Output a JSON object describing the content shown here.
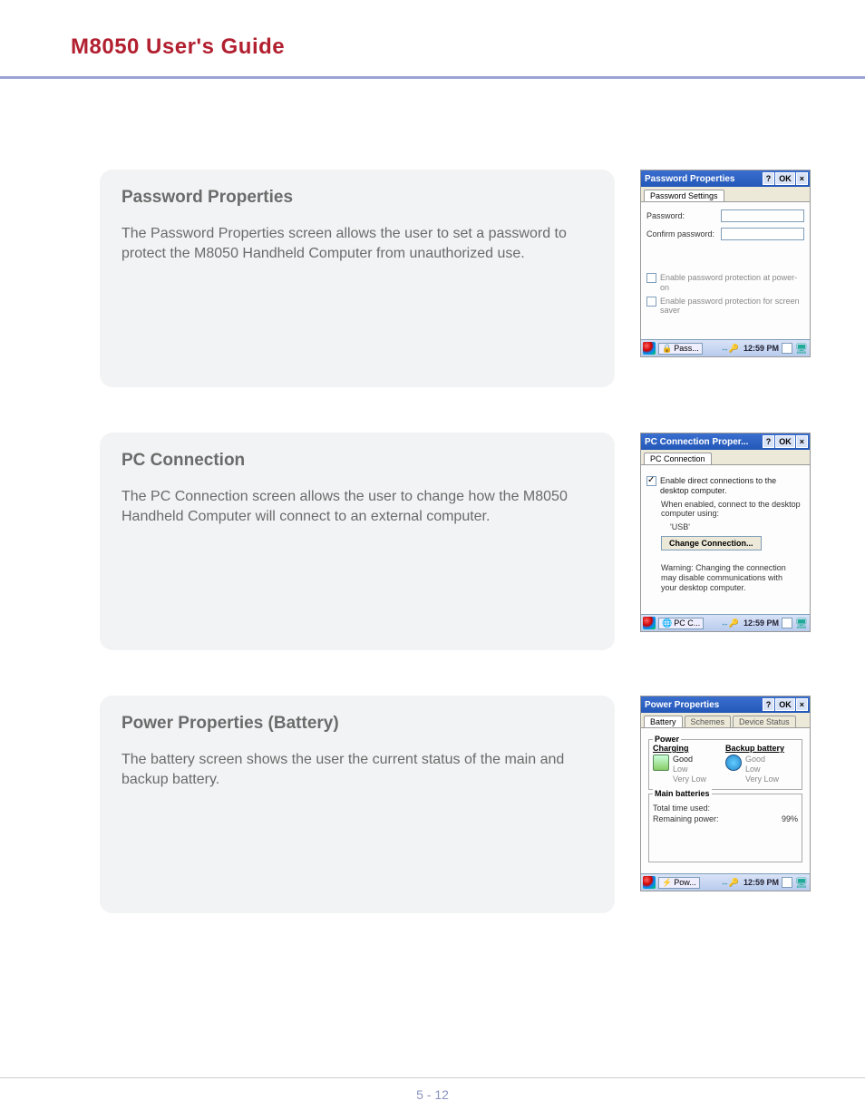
{
  "header": {
    "title": "M8050 User's Guide"
  },
  "sections": [
    {
      "heading": "Password Properties",
      "body": "The Password Properties screen allows the user to set a password to protect the M8050 Handheld Computer from unauthorized use."
    },
    {
      "heading": "PC Connection",
      "body": "The PC Connection screen allows the user to change how the M8050 Handheld Computer will connect to an external computer."
    },
    {
      "heading": "Power Properties (Battery)",
      "body": "The battery screen shows the user the current status of the main and backup battery."
    }
  ],
  "screenshot1": {
    "title": "Password Properties",
    "help_btn": "?",
    "ok_btn": "OK",
    "close_btn": "×",
    "tab": "Password Settings",
    "label_password": "Password:",
    "label_confirm": "Confirm password:",
    "chk1": "Enable password protection at power-on",
    "chk2": "Enable password protection for screen saver",
    "taskbar_app": "Pass...",
    "taskbar_time": "12:59 PM"
  },
  "screenshot2": {
    "title": "PC Connection Proper...",
    "help_btn": "?",
    "ok_btn": "OK",
    "close_btn": "×",
    "tab": "PC Connection",
    "chk_label": "Enable direct connections to the desktop computer.",
    "note1": "When enabled, connect to the desktop computer using:",
    "conn_type": "'USB'",
    "change_btn": "Change Connection...",
    "warning": "Warning: Changing the connection may disable communications with your desktop computer.",
    "taskbar_app": "PC C...",
    "taskbar_time": "12:59 PM"
  },
  "screenshot3": {
    "title": "Power Properties",
    "help_btn": "?",
    "ok_btn": "OK",
    "close_btn": "×",
    "tab1": "Battery",
    "tab2": "Schemes",
    "tab3": "Device Status",
    "legend_power": "Power",
    "col_charging": "Charging",
    "col_backup": "Backup battery",
    "good": "Good",
    "low": "Low",
    "very_low": "Very Low",
    "legend_main": "Main batteries",
    "total_time": "Total time used:",
    "remaining": "Remaining power:",
    "remaining_val": "99%",
    "taskbar_app": "Pow...",
    "taskbar_time": "12:59 PM"
  },
  "footer": {
    "page": "5 - 12"
  }
}
